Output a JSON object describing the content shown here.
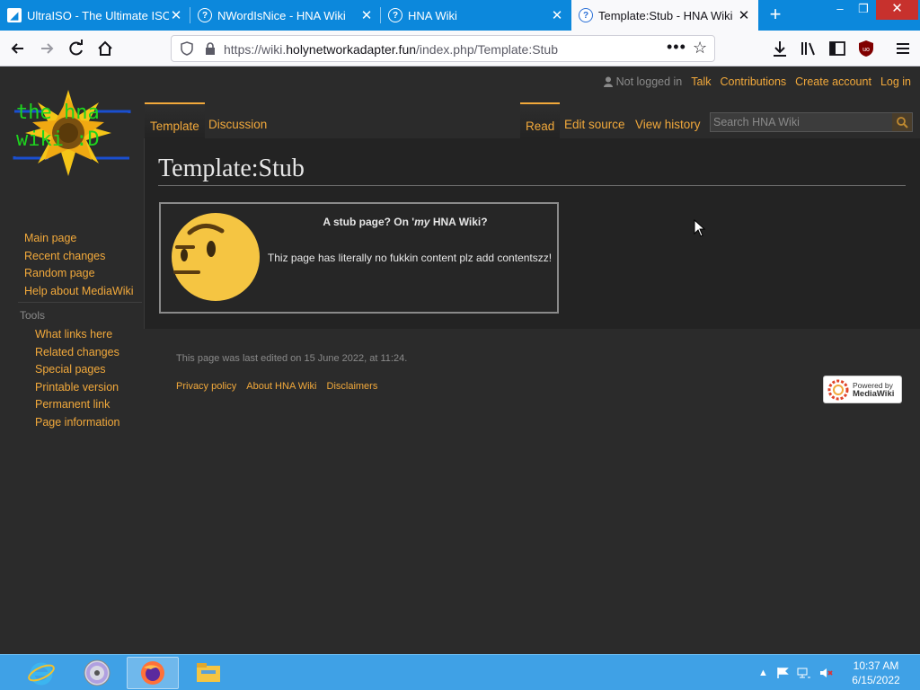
{
  "browser": {
    "tabs": [
      {
        "title": "UltraISO - The Ultimate ISO",
        "active": false
      },
      {
        "title": "NWordIsNice - HNA Wiki",
        "active": false
      },
      {
        "title": "HNA Wiki",
        "active": false
      },
      {
        "title": "Template:Stub - HNA Wiki",
        "active": true
      }
    ],
    "new_tab": "+",
    "url_prefix": "https://wiki.",
    "url_domain": "holynetworkadapter.fun",
    "url_path": "/index.php/Template:Stub",
    "win_controls": {
      "minimize": "–",
      "maximize": "❐",
      "close": "✕"
    }
  },
  "wiki": {
    "personal": {
      "not_logged_in": "Not logged in",
      "talk": "Talk",
      "contributions": "Contributions",
      "create_account": "Create account",
      "log_in": "Log in"
    },
    "logo_text_line1": "the hna",
    "logo_text_line2": "wiki :D",
    "namespace_tabs": {
      "template": "Template",
      "discussion": "Discussion"
    },
    "view_tabs": {
      "read": "Read",
      "edit_source": "Edit source",
      "view_history": "View history"
    },
    "search_placeholder": "Search HNA Wiki",
    "heading": "Template:Stub",
    "stub": {
      "title_pre": "A stub page? On '",
      "title_em": "my",
      "title_post": " HNA Wiki?",
      "text": "Thiz page has literally no fukkin content plz add contentszz!"
    },
    "nav": [
      "Main page",
      "Recent changes",
      "Random page",
      "Help about MediaWiki"
    ],
    "tools_heading": "Tools",
    "tools": [
      "What links here",
      "Related changes",
      "Special pages",
      "Printable version",
      "Permanent link",
      "Page information"
    ],
    "last_modified": "This page was last edited on 15 June 2022, at 11:24.",
    "footer": {
      "privacy": "Privacy policy",
      "about": "About HNA Wiki",
      "disclaimers": "Disclaimers"
    },
    "powered_line1": "Powered by",
    "powered_line2": "MediaWiki"
  },
  "taskbar": {
    "time": "10:37 AM",
    "date": "6/15/2022"
  },
  "colors": {
    "tab_strip": "#0c88dc",
    "link": "#f2a93b",
    "page_bg": "#2b2b2b",
    "taskbar": "#3fa1e6"
  }
}
